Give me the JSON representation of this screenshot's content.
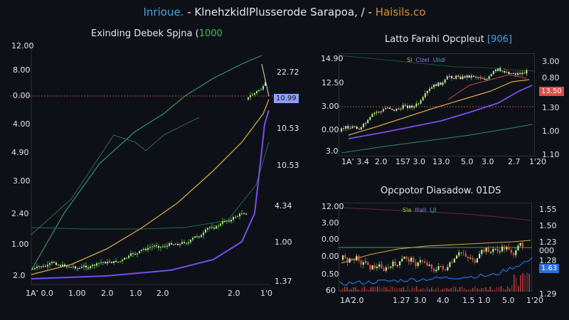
{
  "header": {
    "part1": "Inrioue.",
    "part2": " - KlnehzkidlPlusserode Sarapoa, / - ",
    "part3": "Haisils.co"
  },
  "colors": {
    "background": "#0d1117",
    "candle_up": "#9fe870",
    "candle_down": "#e24a4a",
    "ma_yellow": "#e1b14b",
    "ma_purple": "#8f62f0",
    "ma_green": "#2f8a57",
    "ma_blue": "#2a6ed6",
    "ref_line": "#d04a4a"
  },
  "left_panel": {
    "title": "Exinding Debek Spjna (",
    "title_value": "1000",
    "y_left": [
      "12.00",
      "8.00",
      "0.00",
      "4.00",
      "4.90",
      "3.00",
      "2.40",
      "1.00",
      "2.0"
    ],
    "y_right": [
      "22.72",
      "10.53",
      "10.53",
      "4.34",
      "1.00",
      "1.37"
    ],
    "price_tag": "10.99",
    "x_ticks": [
      "1A’ 0.0",
      "1.00",
      "2.0",
      "1.0",
      "2.0",
      "2.0",
      "1'0"
    ]
  },
  "top_right_panel": {
    "title": "Latto Farahi Opcpleut",
    "title_badge": "[906]",
    "legend": [
      "Sl",
      "Clzel",
      "Ulidi"
    ],
    "y_left": [
      "14.90",
      "12.50",
      "3.00",
      "0.00",
      "3.0"
    ],
    "y_right": [
      "3.00",
      "0.80",
      "1.30",
      "1.00",
      "1.10"
    ],
    "price_tag": "13.50",
    "x_ticks": [
      "1A’ 3.4",
      "2.0",
      "1S7 3.0",
      "13.0",
      "5.0",
      "3.0",
      "2.7",
      "1'20"
    ]
  },
  "bottom_right_panel": {
    "title": "Opcpotor Diasadow. 01DS",
    "legend": [
      "Sla",
      "lllall",
      "LJl"
    ],
    "y_left": [
      "12.00",
      "3.00",
      "0.00",
      "0.00",
      "0.50",
      "60"
    ],
    "y_right": [
      "1.55",
      "1.50",
      "1.23",
      "000",
      "1.28",
      "1.29"
    ],
    "price_tag": "1.63",
    "x_ticks": [
      "1A’",
      "2.0",
      "1.27",
      "3.0",
      "4.0",
      "1.5",
      "1.0",
      "5.0",
      "1'20"
    ]
  }
}
